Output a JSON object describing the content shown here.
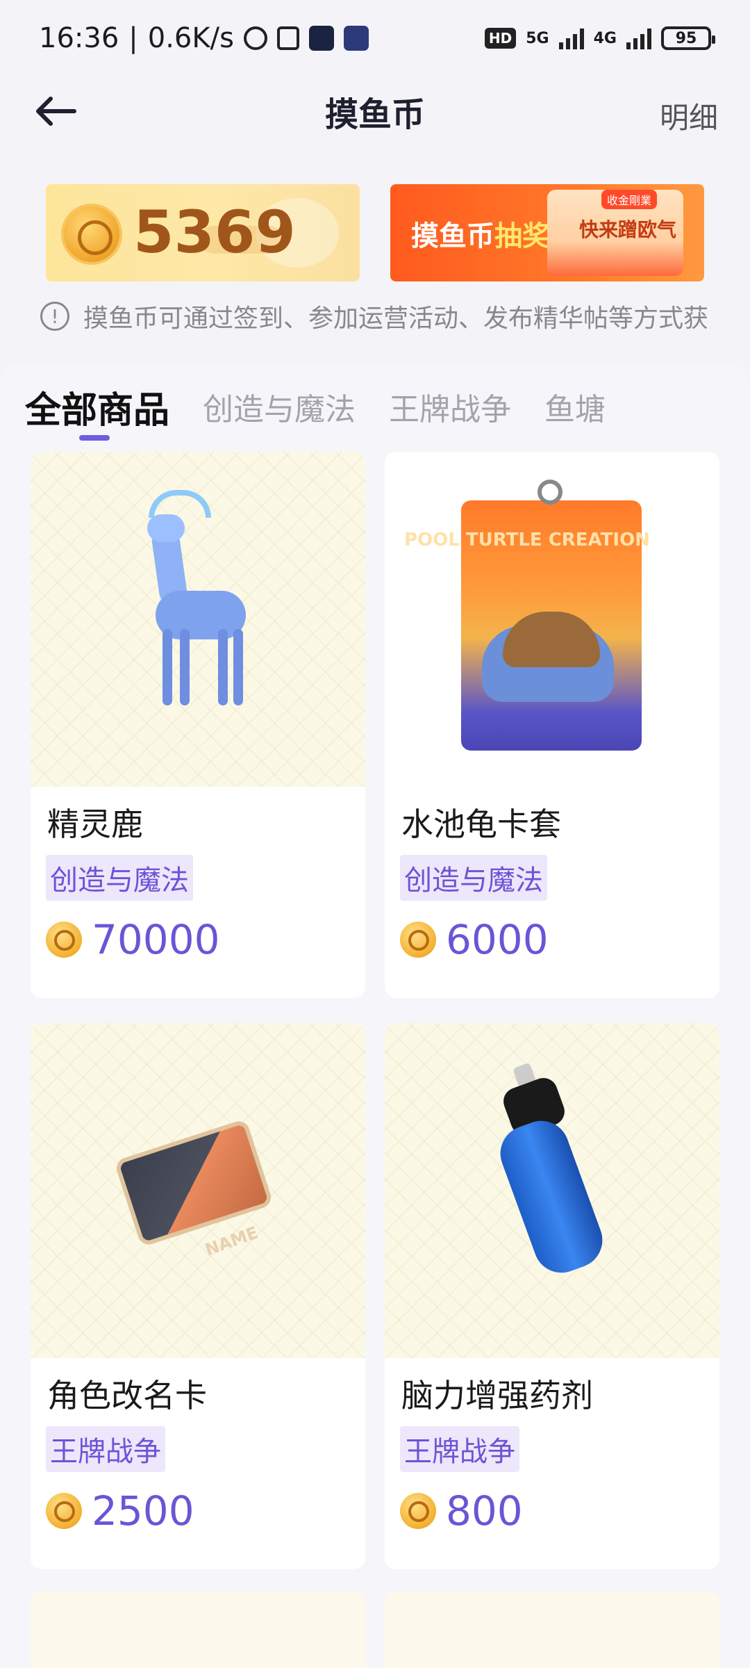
{
  "status_bar": {
    "time": "16:36",
    "speed": "0.6K/s",
    "network_1": "5G",
    "network_2": "4G",
    "battery": "95",
    "hd": "HD"
  },
  "header": {
    "title": "摸鱼币",
    "detail_label": "明细"
  },
  "coin_banner": {
    "amount": "5369"
  },
  "lottery_banner": {
    "title_part1": "摸鱼币",
    "title_part2": "抽奖",
    "envelope_tag": "收金剛業",
    "envelope_text": "快来蹭欧气"
  },
  "notice": {
    "text": "摸鱼币可通过签到、参加运营活动、发布精华帖等方式获"
  },
  "tabs": [
    {
      "label": "全部商品",
      "active": true
    },
    {
      "label": "创造与魔法",
      "active": false
    },
    {
      "label": "王牌战争",
      "active": false
    },
    {
      "label": "鱼塘",
      "active": false
    }
  ],
  "products": [
    {
      "name": "精灵鹿",
      "tag": "创造与魔法",
      "price": "70000"
    },
    {
      "name": "水池龟卡套",
      "tag": "创造与魔法",
      "price": "6000",
      "image_text": "POOL TURTLE CREATION"
    },
    {
      "name": "角色改名卡",
      "tag": "王牌战争",
      "price": "2500",
      "image_text": "NAME"
    },
    {
      "name": "脑力增强药剂",
      "tag": "王牌战争",
      "price": "800"
    }
  ],
  "colors": {
    "accent": "#6c54d6",
    "tag_bg": "#ece7fb",
    "coin_text": "#a0561a",
    "lottery_bg": "#ff6a25"
  }
}
